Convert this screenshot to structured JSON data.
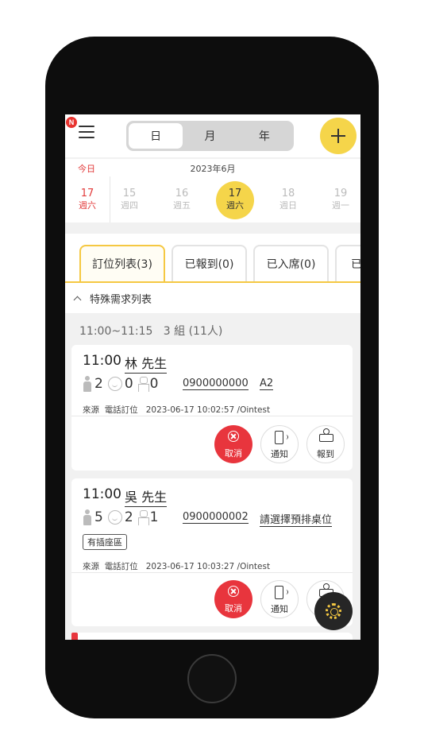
{
  "topbar": {
    "badge": "N",
    "segments": [
      {
        "label": "日",
        "active": true
      },
      {
        "label": "月",
        "active": false
      },
      {
        "label": "年",
        "active": false
      }
    ]
  },
  "calendar": {
    "today_label": "今日",
    "month_label": "2023年6月",
    "days": [
      {
        "num": "17",
        "weekday": "週六",
        "state": "today"
      },
      {
        "num": "15",
        "weekday": "週四",
        "state": "normal"
      },
      {
        "num": "16",
        "weekday": "週五",
        "state": "normal"
      },
      {
        "num": "17",
        "weekday": "週六",
        "state": "selected"
      },
      {
        "num": "18",
        "weekday": "週日",
        "state": "normal"
      },
      {
        "num": "19",
        "weekday": "週一",
        "state": "normal"
      }
    ]
  },
  "tabs": [
    {
      "label": "訂位列表(3)",
      "active": true
    },
    {
      "label": "已報到(0)",
      "active": false
    },
    {
      "label": "已入席(0)",
      "active": false
    },
    {
      "label": "已",
      "active": false
    }
  ],
  "special_requests": {
    "label": "特殊需求列表"
  },
  "slot": {
    "time_range": "11:00~11:15",
    "summary": "3 組 (11人)"
  },
  "bookings": [
    {
      "time": "11:00",
      "name": "林 先生",
      "adults": "2",
      "children": "0",
      "seats": "0",
      "phone": "0900000000",
      "table": "A2",
      "tag": "",
      "source_label": "來源",
      "source": "電話訂位",
      "created": "2023-06-17 10:02:57 /Ointest"
    },
    {
      "time": "11:00",
      "name": "吳 先生",
      "adults": "5",
      "children": "2",
      "seats": "1",
      "phone": "0900000002",
      "table": "請選擇預排桌位",
      "tag": "有插座區",
      "source_label": "來源",
      "source": "電話訂位",
      "created": "2023-06-17 10:03:27 /Ointest"
    }
  ],
  "actions": {
    "cancel": "取消",
    "notify": "通知",
    "checkin": "報到"
  },
  "colors": {
    "accent": "#f5d54a",
    "danger": "#e8353d",
    "today": "#e23b3b"
  }
}
